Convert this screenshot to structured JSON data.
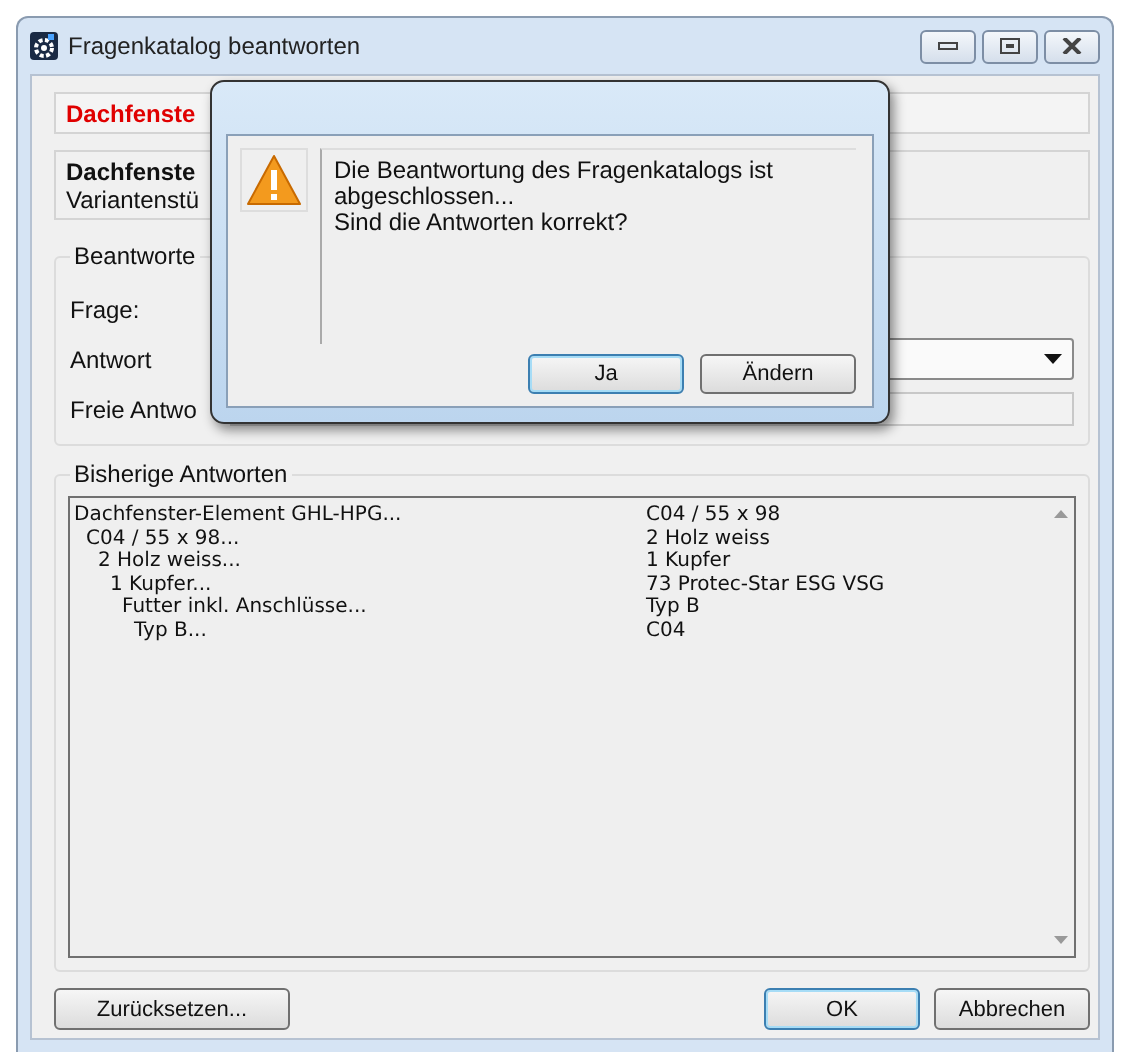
{
  "window": {
    "title": "Fragenkatalog beantworten"
  },
  "header_field": {
    "value": "Dachfenste"
  },
  "info_box": {
    "title": "Dachfenste",
    "subtitle": "Variantenstü"
  },
  "answer_group": {
    "title": "Beantworte",
    "fields": [
      {
        "label": "Frage:",
        "kind": "text"
      },
      {
        "label": "Antwort",
        "kind": "combo"
      },
      {
        "label": "Freie Antwo",
        "kind": "input"
      }
    ]
  },
  "history": {
    "title": "Bisherige Antworten",
    "rows": [
      {
        "question": "Dachfenster-Element GHL-HPG...",
        "answer": "C04 / 55 x 98",
        "children": [
          {
            "question": "C04 / 55 x 98...",
            "answer": "2 Holz weiss",
            "children": [
              {
                "question": "2 Holz weiss...",
                "answer": "1 Kupfer",
                "children": [
                  {
                    "question": "1 Kupfer...",
                    "answer": "73 Protec-Star ESG VSG",
                    "children": [
                      {
                        "question": "Futter inkl. Anschlüsse...",
                        "answer": "Typ B",
                        "children": [
                          {
                            "question": "Typ B...",
                            "answer": "C04"
                          }
                        ]
                      }
                    ]
                  }
                ]
              }
            ]
          }
        ]
      }
    ]
  },
  "footer_buttons": [
    {
      "label": "Zurücksetzen...",
      "default": false
    },
    {
      "label": "OK",
      "default": true
    },
    {
      "label": "Abbrechen",
      "default": false
    }
  ],
  "dialog": {
    "message": [
      "Die Beantwortung des Fragenkatalogs ist",
      "abgeschlossen...",
      "Sind die Antworten korrekt?"
    ],
    "buttons": [
      {
        "label": "Ja",
        "default": true
      },
      {
        "label": "Ändern",
        "default": false
      }
    ]
  }
}
